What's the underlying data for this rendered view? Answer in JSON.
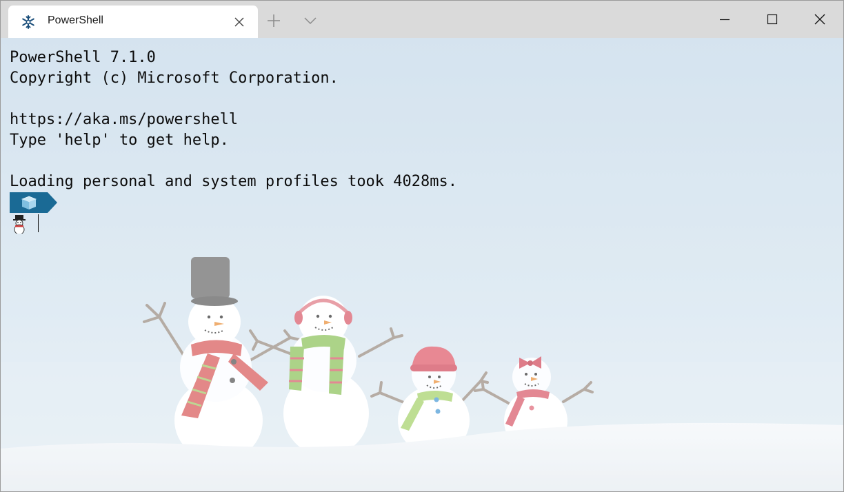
{
  "tab": {
    "title": "PowerShell"
  },
  "icons": {
    "tab": "snowflake-icon",
    "close_tab": "close-icon",
    "new_tab": "plus-icon",
    "dropdown": "chevron-down-icon",
    "minimize": "minimize-icon",
    "maximize": "maximize-icon",
    "close_window": "close-icon",
    "prompt_segment": "cube-icon",
    "prompt_glyph": "snowman-icon"
  },
  "terminal": {
    "lines": [
      "PowerShell 7.1.0",
      "Copyright (c) Microsoft Corporation.",
      "",
      "https://aka.ms/powershell",
      "Type 'help' to get help.",
      "",
      "Loading personal and system profiles took 4028ms."
    ]
  },
  "colors": {
    "tab_bar": "#dadada",
    "tab_active": "#ffffff",
    "prompt_segment": "#1a6a95",
    "text": "#0c0c0c"
  }
}
